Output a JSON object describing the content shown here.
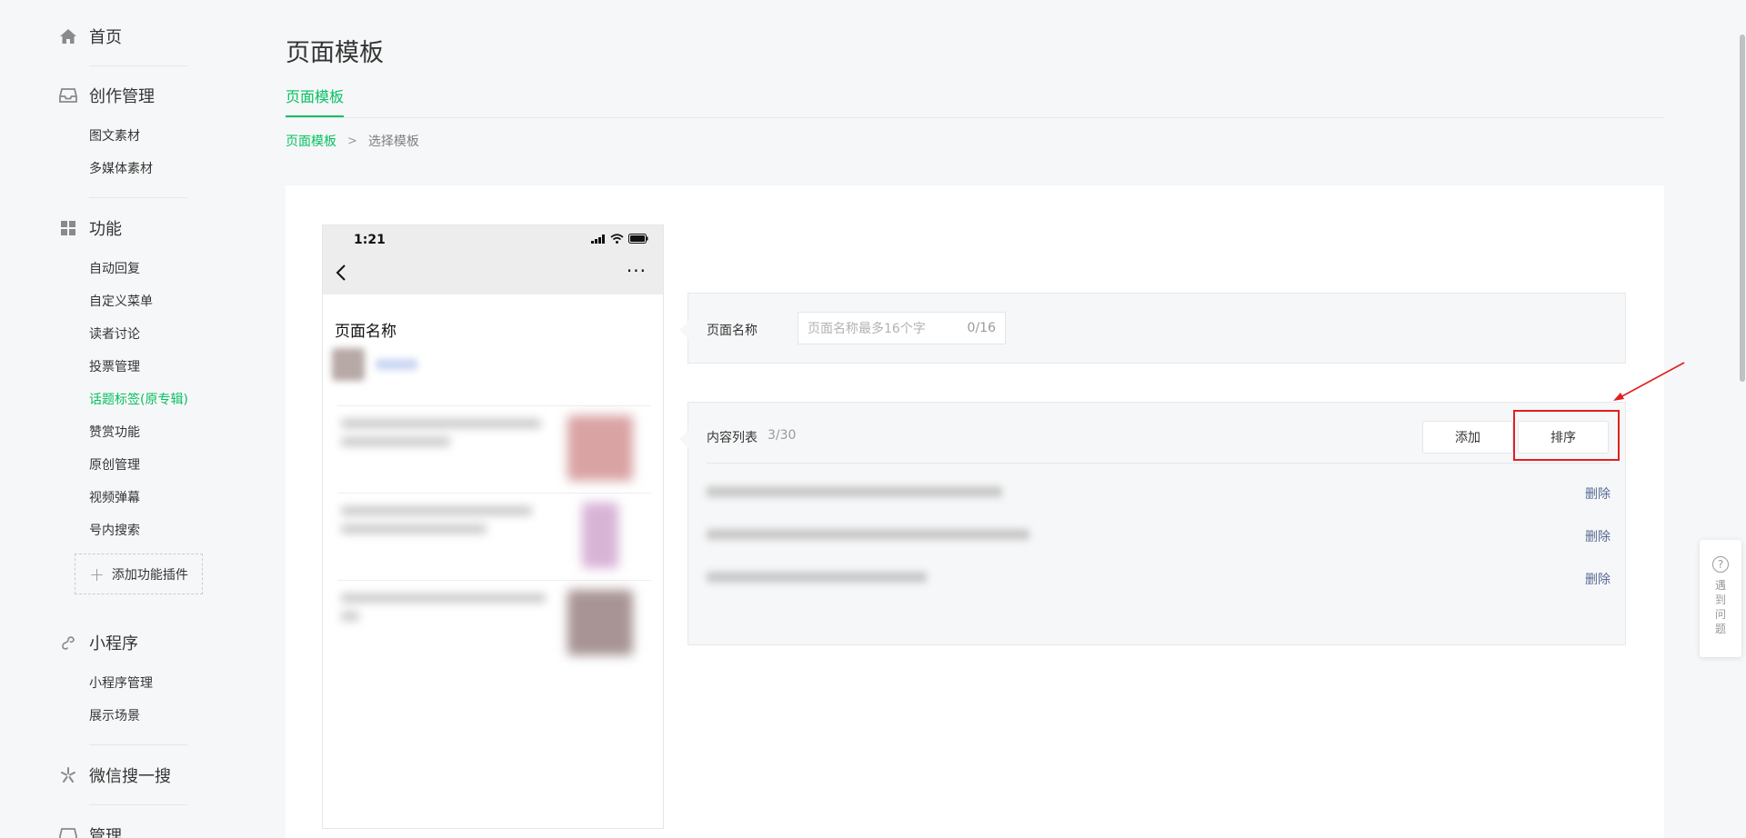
{
  "sidebar": {
    "home": {
      "label": "首页",
      "icon": "home-icon"
    },
    "creation": {
      "label": "创作管理",
      "icon": "inbox-icon",
      "items": [
        "图文素材",
        "多媒体素材"
      ]
    },
    "features": {
      "label": "功能",
      "icon": "grid-icon",
      "items": [
        "自动回复",
        "自定义菜单",
        "读者讨论",
        "投票管理",
        "话题标签(原专辑)",
        "赞赏功能",
        "原创管理",
        "视频弹幕",
        "号内搜索"
      ],
      "active_item": "话题标签(原专辑)"
    },
    "add_plugin": "添加功能插件",
    "miniprogram": {
      "label": "小程序",
      "icon": "miniprogram-icon",
      "items": [
        "小程序管理",
        "展示场景"
      ]
    },
    "search": {
      "label": "微信搜一搜",
      "icon": "search-star-icon"
    },
    "manage": {
      "label": "管理",
      "icon": "manage-icon"
    }
  },
  "page": {
    "title": "页面模板",
    "tab": "页面模板",
    "breadcrumb": {
      "parent": "页面模板",
      "separator": ">",
      "current": "选择模板"
    }
  },
  "phone": {
    "time": "1:21",
    "page_name": "页面名称"
  },
  "form": {
    "name_label": "页面名称",
    "name_placeholder": "页面名称最多16个字",
    "name_count": "0/16",
    "list_label": "内容列表",
    "list_count": "3/30",
    "add_button": "添加",
    "sort_button": "排序",
    "delete_label": "删除"
  },
  "help": {
    "label": "遇到问题"
  },
  "colors": {
    "accent": "#07c160",
    "highlight": "#e02020",
    "link": "#576b95"
  }
}
